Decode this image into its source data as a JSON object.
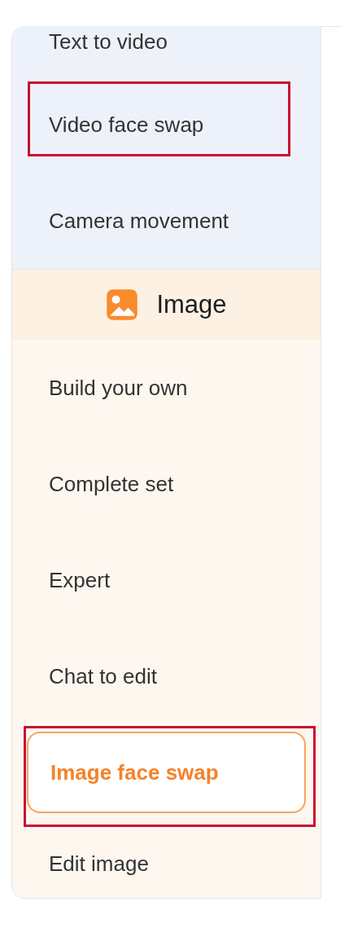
{
  "sections": [
    {
      "kind": "video",
      "items": [
        {
          "label": "Text to video",
          "selected": false,
          "highlighted": false
        },
        {
          "label": "Video face swap",
          "selected": false,
          "highlighted": true
        },
        {
          "label": "Camera movement",
          "selected": false,
          "highlighted": false
        }
      ]
    },
    {
      "kind": "image",
      "header": "Image",
      "items": [
        {
          "label": "Build your own",
          "selected": false,
          "highlighted": false
        },
        {
          "label": "Complete set",
          "selected": false,
          "highlighted": false
        },
        {
          "label": "Expert",
          "selected": false,
          "highlighted": false
        },
        {
          "label": "Chat to edit",
          "selected": false,
          "highlighted": false
        },
        {
          "label": "Image face swap",
          "selected": true,
          "highlighted": true
        },
        {
          "label": "Edit image",
          "selected": false,
          "highlighted": false
        }
      ]
    }
  ]
}
